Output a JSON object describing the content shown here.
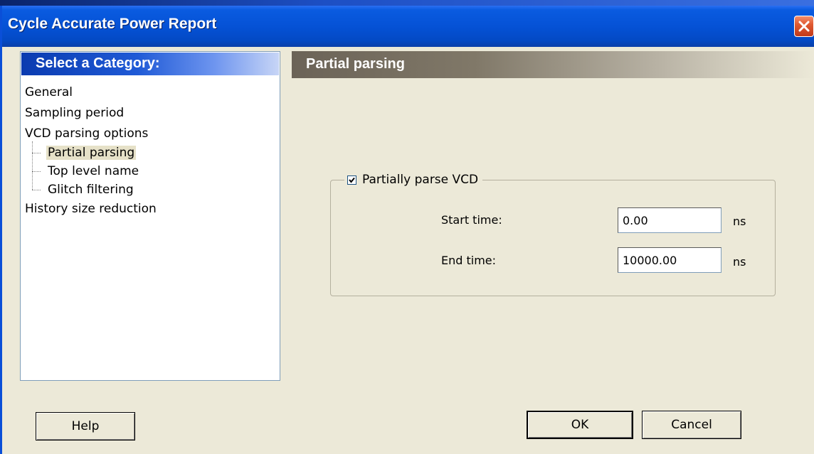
{
  "window": {
    "title": "Cycle Accurate Power Report",
    "close_icon": "close-icon"
  },
  "category_panel": {
    "header": "Select a Category:",
    "items": [
      {
        "label": "General",
        "level": 0,
        "selected": false
      },
      {
        "label": "Sampling period",
        "level": 0,
        "selected": false
      },
      {
        "label": "VCD parsing options",
        "level": 0,
        "selected": false
      },
      {
        "label": "Partial parsing",
        "level": 1,
        "selected": true
      },
      {
        "label": "Top level name",
        "level": 1,
        "selected": false
      },
      {
        "label": "Glitch filtering",
        "level": 1,
        "selected": false
      },
      {
        "label": "History size reduction",
        "level": 0,
        "selected": false
      }
    ]
  },
  "page": {
    "header": "Partial parsing",
    "group": {
      "checkbox_label": "Partially parse VCD",
      "checked": true,
      "start_time_label": "Start time:",
      "start_time_value": "0.00",
      "start_time_unit": "ns",
      "end_time_label": "End time:",
      "end_time_value": "10000.00",
      "end_time_unit": "ns"
    }
  },
  "buttons": {
    "help": "Help",
    "ok": "OK",
    "cancel": "Cancel"
  },
  "colors": {
    "titlebar": "#0552d6",
    "dialog_bg": "#ece9d8",
    "category_header": "#1f5ad6",
    "page_header": "#807868"
  }
}
